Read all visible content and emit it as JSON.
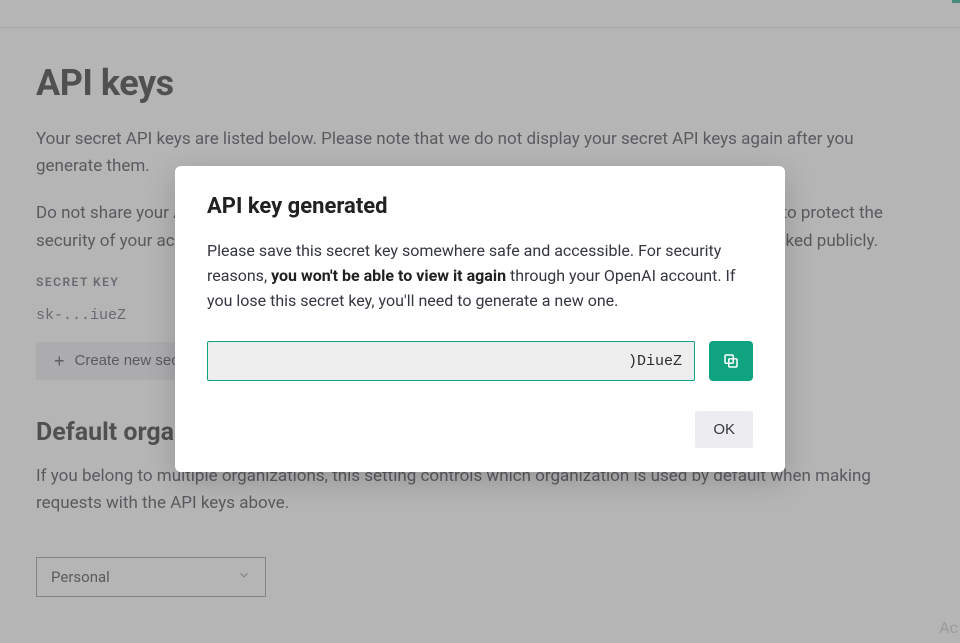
{
  "page": {
    "title": "API keys",
    "intro": "Your secret API keys are listed below. Please note that we do not display your secret API keys again after you generate them.",
    "warning": "Do not share your API key with others, or expose it in the browser or other client-side code. In order to protect the security of your account, OpenAI may also automatically rotate any API key that we've found has leaked publicly.",
    "secret_key_label": "SECRET KEY",
    "secret_key_value": "sk-...iueZ",
    "create_button": "Create new secret key",
    "default_org_title": "Default organization",
    "default_org_text": "If you belong to multiple organizations, this setting controls which organization is used by default when making requests with the API keys above.",
    "org_selected": "Personal"
  },
  "modal": {
    "title": "API key generated",
    "text_before": "Please save this secret key somewhere safe and accessible. For security reasons, ",
    "text_strong": "you won't be able to view it again",
    "text_after": " through your OpenAI account. If you lose this secret key, you'll need to generate a new one.",
    "key_value": ")DiueZ",
    "ok_label": "OK"
  },
  "hint": {
    "activate": "Ac"
  }
}
